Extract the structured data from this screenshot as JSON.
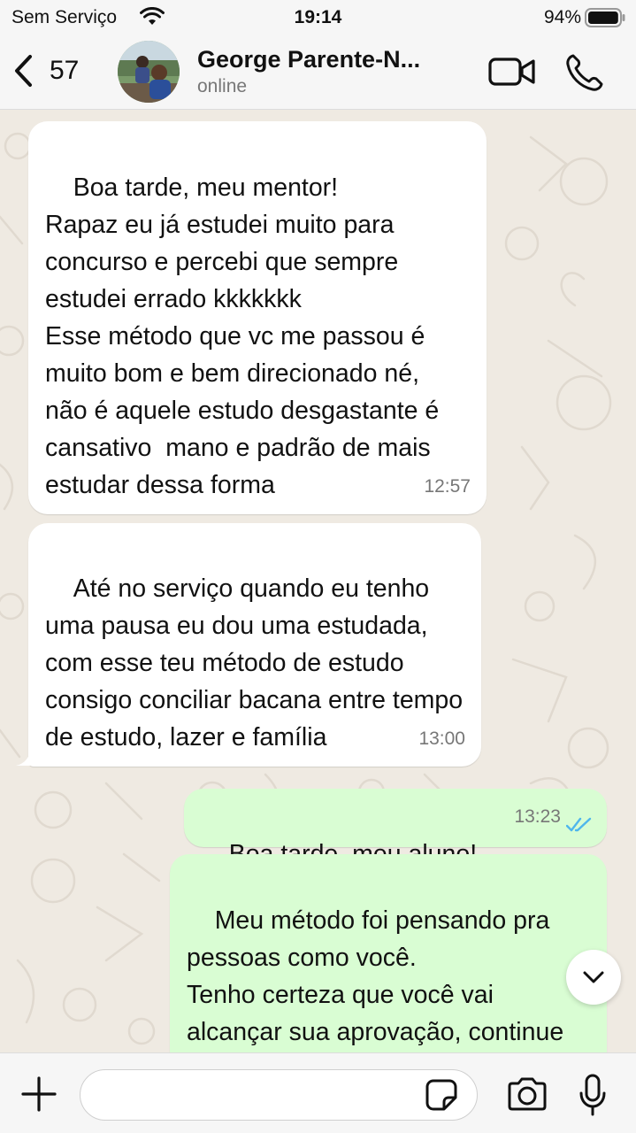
{
  "status_bar": {
    "carrier": "Sem Serviço",
    "time": "19:14",
    "battery_percent": "94%",
    "battery_level": 0.94
  },
  "header": {
    "back_count": "57",
    "contact_name": "George Parente-N...",
    "contact_status": "online"
  },
  "messages": [
    {
      "direction": "incoming",
      "text": "Boa tarde, meu mentor!\nRapaz eu já estudei muito para concurso e percebi que sempre estudei errado kkkkkkk\nEsse método que vc me passou é muito bom e bem direcionado né,  não é aquele estudo desgastante é cansativo  mano e padrão de mais estudar dessa forma",
      "time": "12:57"
    },
    {
      "direction": "incoming",
      "text": "Até no serviço quando eu tenho uma pausa eu dou uma estudada, com esse teu método de estudo consigo conciliar bacana entre tempo de estudo, lazer e família",
      "time": "13:00"
    },
    {
      "direction": "outgoing",
      "text": "Boa tarde, meu aluno!",
      "time": "13:23",
      "status": "read"
    },
    {
      "direction": "outgoing",
      "text": "Meu método foi pensando pra pessoas como você.\nTenho certeza que você vai alcançar sua aprovação, continue fazendo o seu melhor"
    }
  ],
  "input": {
    "placeholder": ""
  },
  "colors": {
    "chat_background": "#efeae2",
    "incoming_bubble": "#ffffff",
    "outgoing_bubble": "#d9fdd3",
    "read_ticks": "#4fb6ec",
    "bar_background": "#f6f6f6"
  },
  "icons": {
    "back": "chevron-left-icon",
    "video_call": "video-camera-icon",
    "voice_call": "phone-icon",
    "scroll_down": "chevron-down-icon",
    "attach": "plus-icon",
    "sticker": "sticker-icon",
    "camera": "camera-icon",
    "microphone": "microphone-icon"
  }
}
